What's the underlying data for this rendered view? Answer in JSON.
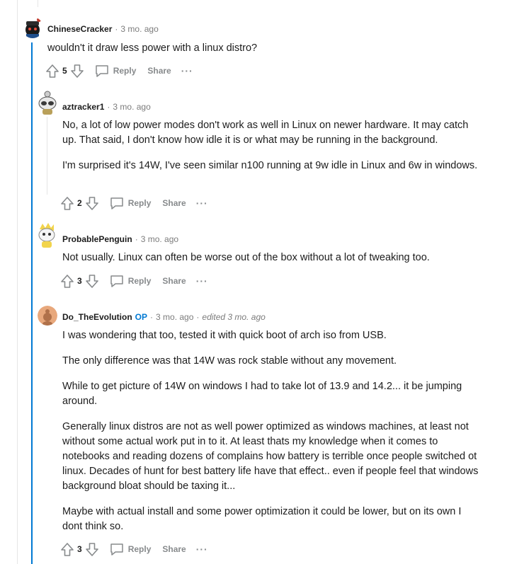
{
  "comments": [
    {
      "author": "ChineseCracker",
      "time": "3 mo. ago",
      "paragraphs": [
        "wouldn't it draw less power with a linux distro?"
      ],
      "score": "5",
      "reply_label": "Reply",
      "share_label": "Share",
      "more_label": "···"
    },
    {
      "author": "aztracker1",
      "time": "3 mo. ago",
      "paragraphs": [
        "No, a lot of low power modes don't work as well in Linux on newer hardware. It may catch up. That said, I don't know how idle it is or what may be running in the background.",
        "I'm surprised it's 14W, I've seen similar n100 running at 9w idle in Linux and 6w in windows."
      ],
      "score": "2",
      "reply_label": "Reply",
      "share_label": "Share",
      "more_label": "···"
    },
    {
      "author": "ProbablePenguin",
      "time": "3 mo. ago",
      "paragraphs": [
        "Not usually. Linux can often be worse out of the box without a lot of tweaking too."
      ],
      "score": "3",
      "reply_label": "Reply",
      "share_label": "Share",
      "more_label": "···"
    },
    {
      "author": "Do_TheEvolution",
      "op_badge": "OP",
      "time": "3 mo. ago",
      "edited": "edited 3 mo. ago",
      "paragraphs": [
        "I was wondering that too, tested it with quick boot of arch iso from USB.",
        "The only difference was that 14W was rock stable without any movement.",
        "While to get picture of 14W on windows I had to take lot of 13.9 and 14.2... it be jumping around.",
        "Generally linux distros are not as well power optimized as windows machines, at least not without some actual work put in to it. At least thats my knowledge when it comes to notebooks and reading dozens of complains how battery is terrible once people switched ot linux. Decades of hunt for best battery life have that effect.. even if people feel that windows background bloat should be taxing it...",
        "Maybe with actual install and some power optimization it could be lower, but on its own I dont think so."
      ],
      "score": "3",
      "reply_label": "Reply",
      "share_label": "Share",
      "more_label": "···"
    }
  ],
  "colors": {
    "accent": "#0079d3",
    "thread_line": "#e5e5e5",
    "meta": "#7c7c7c",
    "action": "#878a8c"
  }
}
